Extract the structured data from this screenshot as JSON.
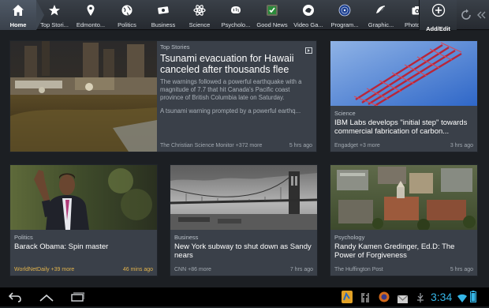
{
  "nav": {
    "tabs": [
      {
        "label": "Home",
        "icon": "home-icon"
      },
      {
        "label": "Top Stori...",
        "icon": "star-icon"
      },
      {
        "label": "Edmonto...",
        "icon": "location-pin-icon"
      },
      {
        "label": "Politics",
        "icon": "globe-icon"
      },
      {
        "label": "Business",
        "icon": "money-icon"
      },
      {
        "label": "Science",
        "icon": "atom-icon"
      },
      {
        "label": "Psycholo...",
        "icon": "brain-icon"
      },
      {
        "label": "Good News",
        "icon": "good-news-icon"
      },
      {
        "label": "Video Ga...",
        "icon": "video-games-icon"
      },
      {
        "label": "Program...",
        "icon": "programming-icon"
      },
      {
        "label": "Graphic...",
        "icon": "graphic-icon"
      },
      {
        "label": "Photogr...",
        "icon": "camera-icon"
      }
    ],
    "add_edit": "Add/Edit"
  },
  "cards": {
    "c1": {
      "category": "Top Stories",
      "title": "Tsunami evacuation for Hawaii canceled after thousands flee",
      "summary1": "The warnings followed a powerful earthquake with a magnitude of 7.7 that hit Canada's Pacific coast province of British Columbia late on Saturday.",
      "summary2": "A tsunami warning prompted by a powerful earthq...",
      "source": "The Christian Science Monitor +372 more",
      "time": "5 hrs ago"
    },
    "c2": {
      "category": "Science",
      "title": "IBM Labs develops \"initial step\" towards commercial fabrication of carbon...",
      "source": "Engadget +3 more",
      "time": "3 hrs ago"
    },
    "c3": {
      "category": "Politics",
      "title": "Barack Obama: Spin master",
      "source": "WorldNetDaily +39 more",
      "time": "46 mins ago"
    },
    "c4": {
      "category": "Business",
      "title": "New York subway to shut down as Sandy nears",
      "source": "CNN +86 more",
      "time": "7 hrs ago"
    },
    "c5": {
      "category": "Psychology",
      "title": "Randy Kamen Gredinger, Ed.D: The Power of Forgiveness",
      "source": "The Huffington Post",
      "time": "5 hrs ago"
    }
  },
  "status": {
    "clock": "3:34"
  },
  "colors": {
    "accent_blue": "#35b6e7",
    "card_bg": "#3a4049",
    "topbar": "#2e343b"
  }
}
